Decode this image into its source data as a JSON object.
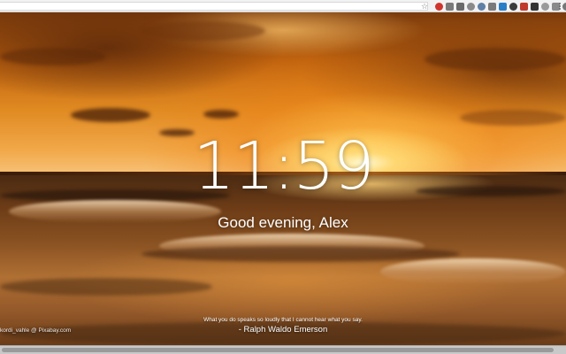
{
  "toolbar": {
    "bookmark_icon": "star-icon",
    "extension_icons": [
      {
        "name": "opera-extension-icon",
        "color": "#d0352d"
      },
      {
        "name": "camera-extension-icon",
        "color": "#7a7a7a"
      },
      {
        "name": "mail-extension-icon",
        "color": "#6a6a6a"
      },
      {
        "name": "mic-extension-icon",
        "color": "#8a8a8a"
      },
      {
        "name": "refresh-extension-icon",
        "color": "#5f7fa6"
      },
      {
        "name": "gear-extension-icon",
        "color": "#7a7a7a"
      },
      {
        "name": "blue-extension-icon",
        "color": "#2a7ec7"
      },
      {
        "name": "panda-extension-icon",
        "color": "#3c3c3c"
      },
      {
        "name": "shield-extension-icon",
        "color": "#c0392b"
      },
      {
        "name": "dark-extension-icon",
        "color": "#333333"
      },
      {
        "name": "circle-extension-icon",
        "color": "#9a9a9a"
      },
      {
        "name": "grid-extension-icon",
        "color": "#8a8a8a"
      },
      {
        "name": "pin-extension-icon",
        "color": "#777777"
      },
      {
        "name": "square-extension-icon",
        "color": "#5a5a5a"
      }
    ],
    "menu_icon": "more-vert-icon"
  },
  "dashboard": {
    "time": "11:59",
    "greeting": "Good evening, Alex",
    "quote": "What you do speaks so loudly that I cannot hear what you say.",
    "author": "- Ralph Waldo Emerson",
    "photo_credit": "kordi_vahle @ Pixabay.com"
  },
  "colors": {
    "text": "#ffffff",
    "sky_top": "#7a3a0c",
    "sun": "#fff8d2"
  }
}
